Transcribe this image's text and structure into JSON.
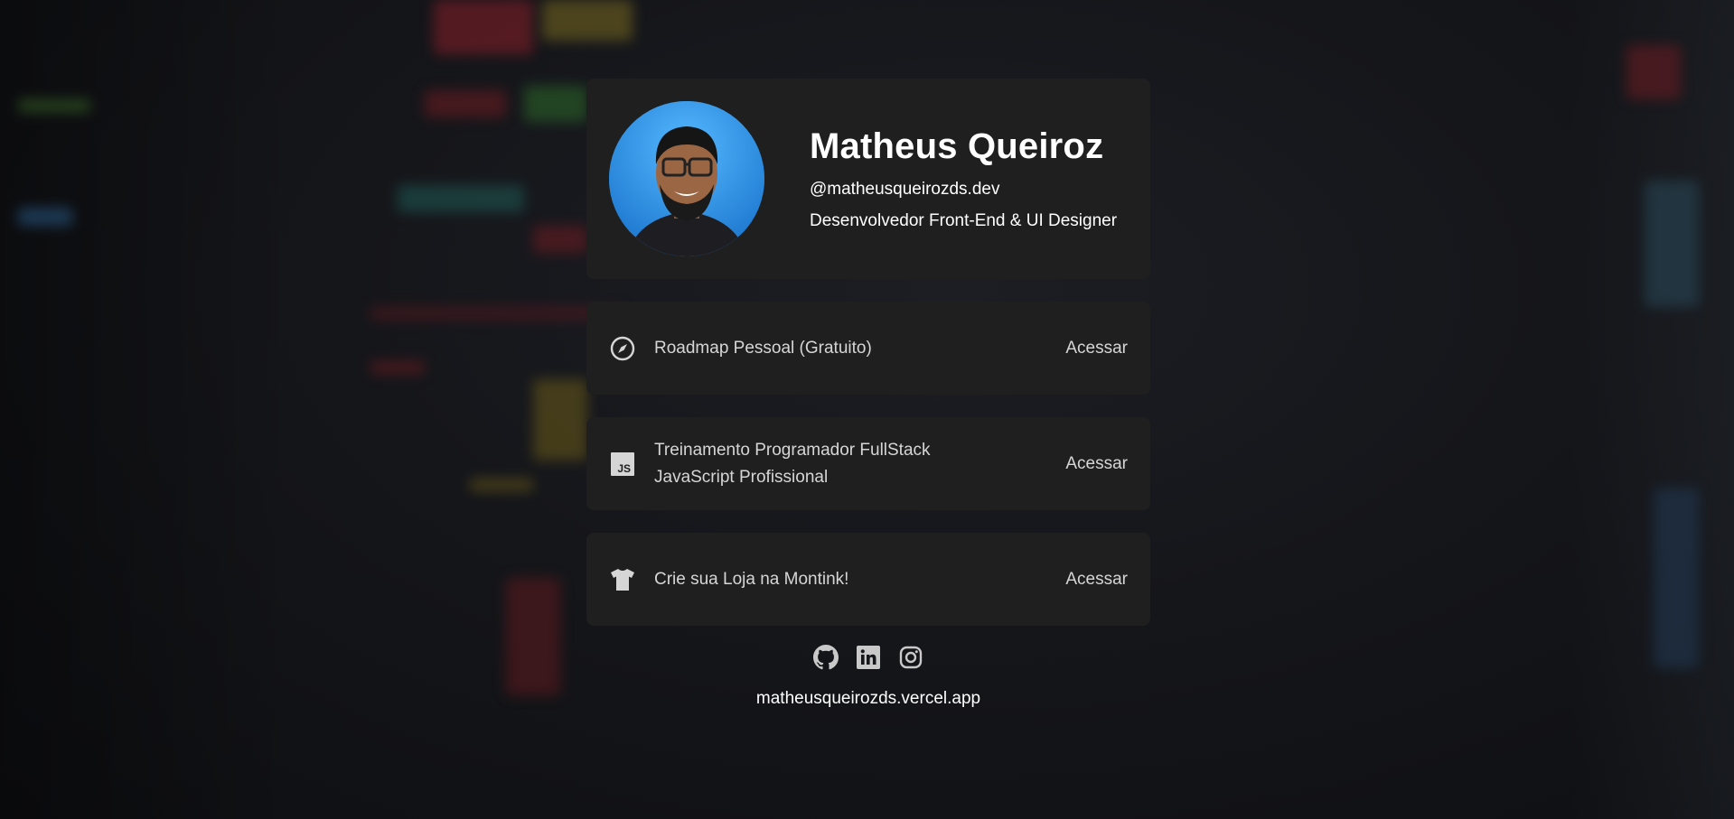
{
  "profile": {
    "name": "Matheus Queiroz",
    "handle": "@matheusqueirozds.dev",
    "role": "Desenvolvedor Front-End & UI Designer",
    "avatar_alt": "avatar"
  },
  "links": [
    {
      "icon": "compass-icon",
      "title_lines": [
        "Roadmap Pessoal (Gratuito)"
      ],
      "action": "Acessar"
    },
    {
      "icon": "javascript-icon",
      "title_lines": [
        "Treinamento Programador FullStack",
        "JavaScript Profissional"
      ],
      "action": "Acessar"
    },
    {
      "icon": "tshirt-icon",
      "title_lines": [
        "Crie sua Loja na Montink!"
      ],
      "action": "Acessar"
    }
  ],
  "socials": [
    "github-icon",
    "linkedin-icon",
    "instagram-icon"
  ],
  "footer": {
    "url": "matheusqueirozds.vercel.app"
  },
  "colors": {
    "background": "#111216",
    "card": "#1f1f1f",
    "text_primary": "#ffffff",
    "text_secondary": "#d6d6d6",
    "avatar_bg": "#2a97f0"
  }
}
